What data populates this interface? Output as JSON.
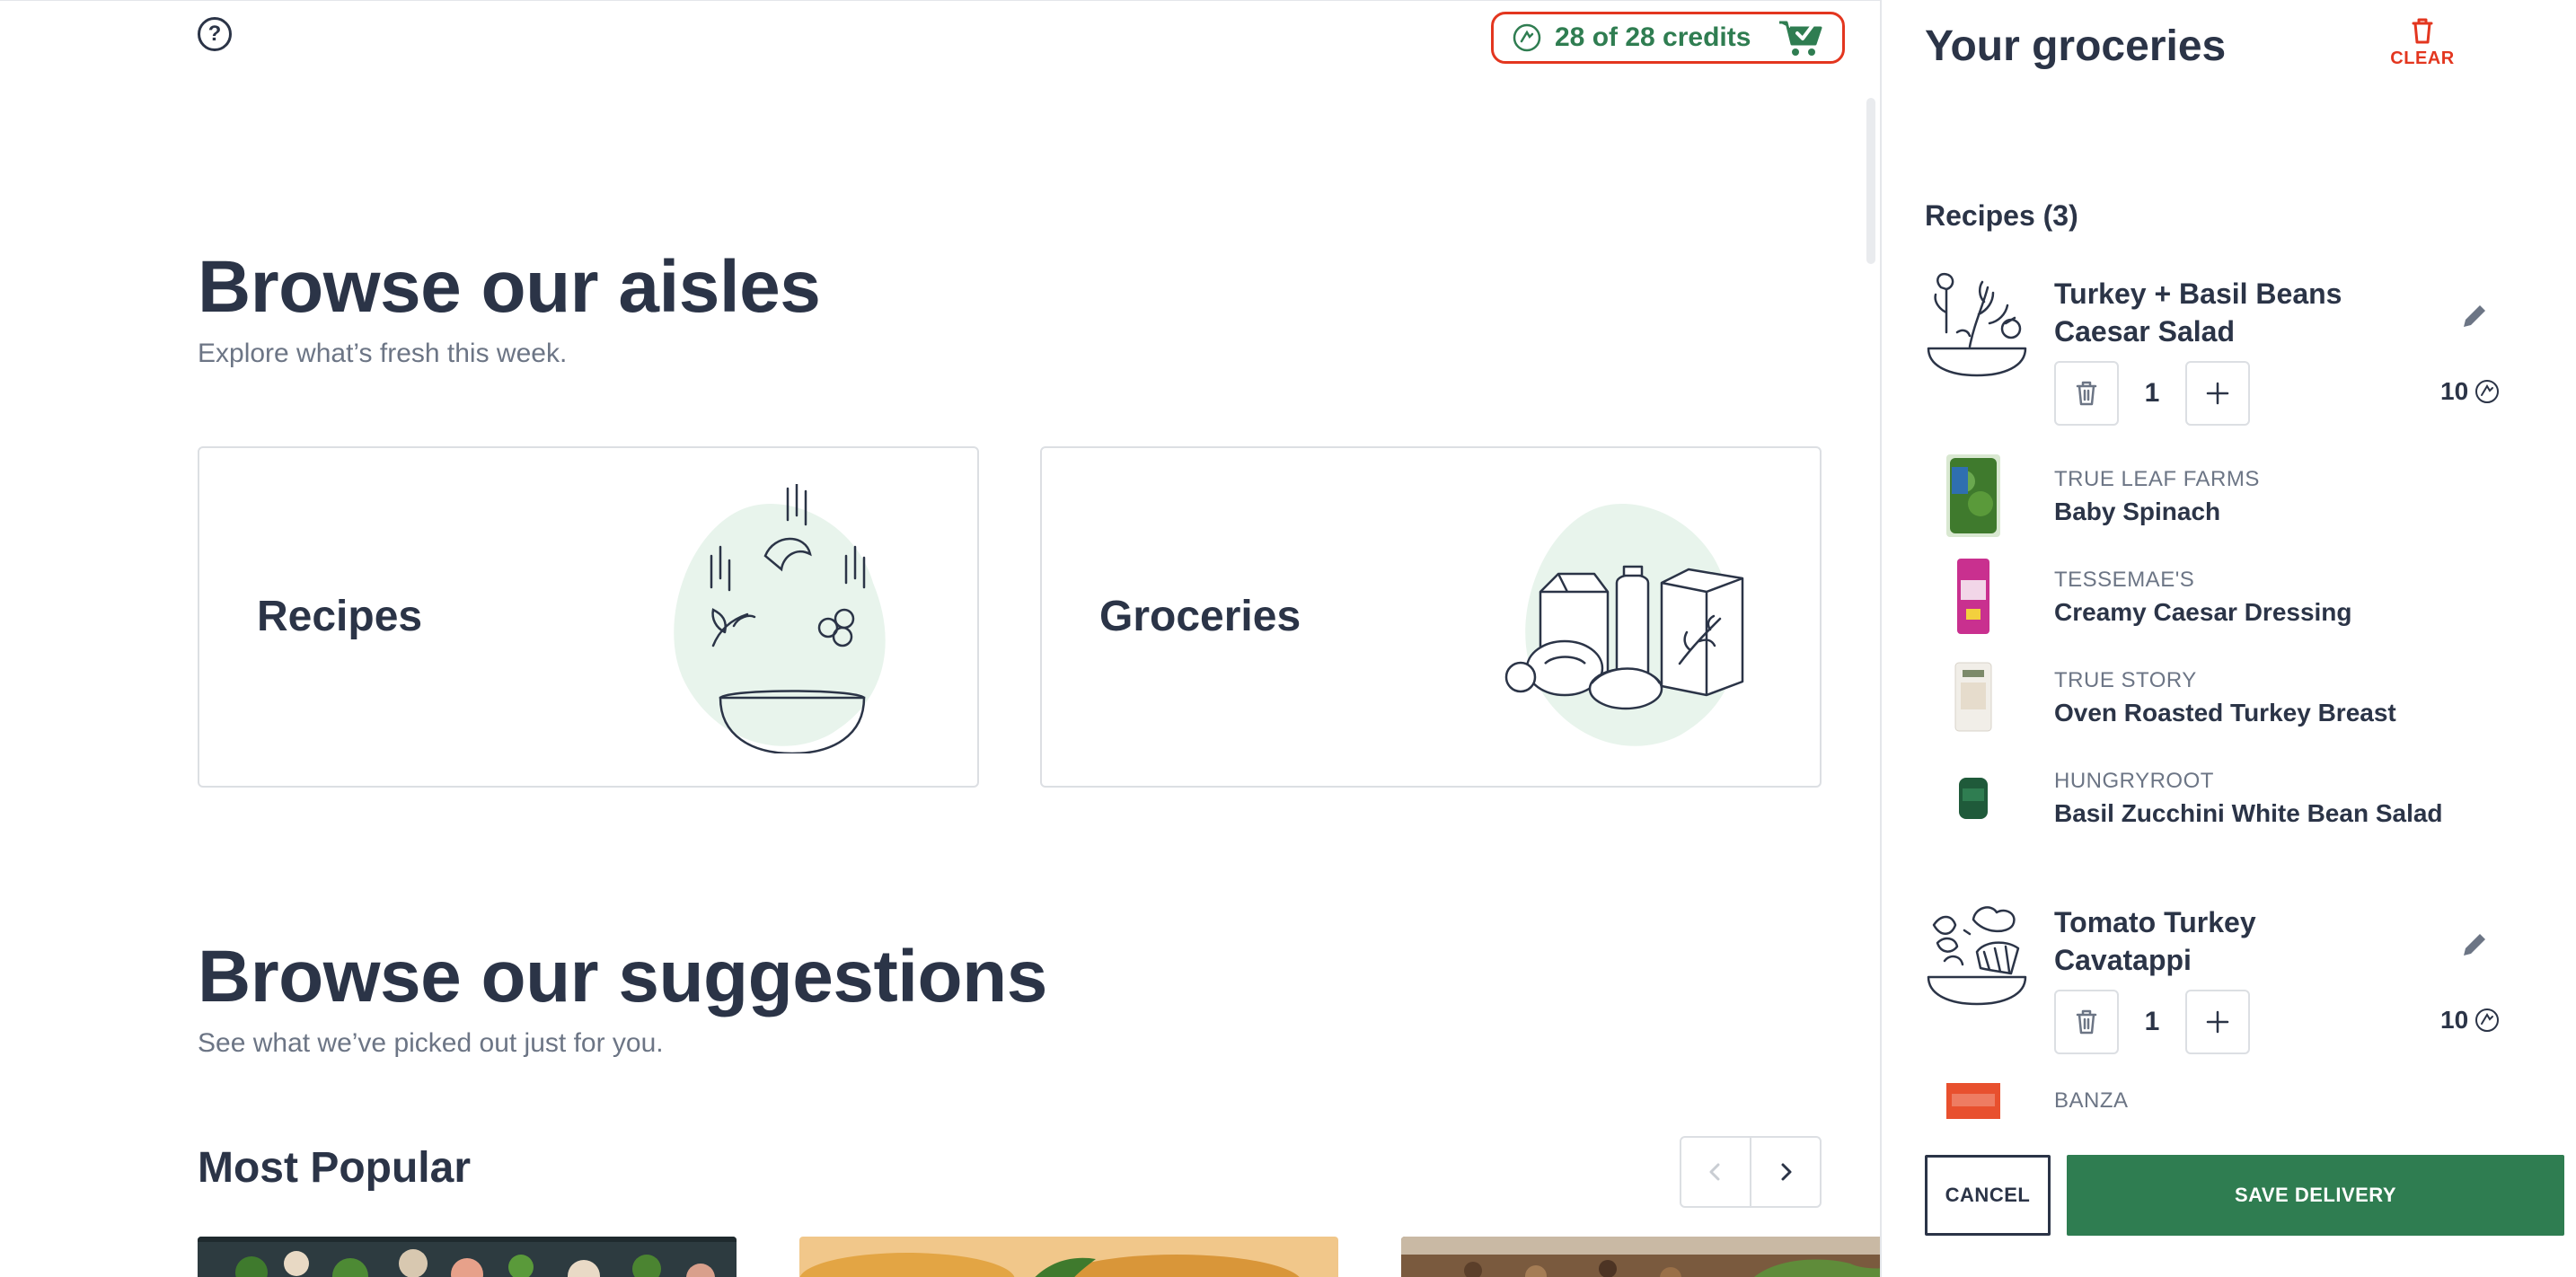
{
  "header": {
    "help_icon": "question-circle-icon",
    "credits_text": "28 of 28 credits",
    "credits_icon": "credit-coin-icon",
    "cart_icon": "cart-check-icon"
  },
  "aisles": {
    "title": "Browse our aisles",
    "subtitle": "Explore what’s fresh this week.",
    "cards": [
      {
        "label": "Recipes",
        "icon": "salad-bowl-illustration"
      },
      {
        "label": "Groceries",
        "icon": "grocery-items-illustration"
      }
    ]
  },
  "suggestions": {
    "title": "Browse our suggestions",
    "subtitle": "See what we’ve picked out just for you.",
    "row_title": "Most Popular",
    "prev_icon": "chevron-left-icon",
    "next_icon": "chevron-right-icon"
  },
  "sidebar": {
    "title": "Your groceries",
    "clear_label": "CLEAR",
    "recipes_label": "Recipes (3)",
    "recipes": [
      {
        "name": "Turkey + Basil Beans Caesar Salad",
        "quantity": "1",
        "credits": "10",
        "ingredients": [
          {
            "brand": "TRUE LEAF FARMS",
            "name": "Baby Spinach"
          },
          {
            "brand": "TESSEMAE'S",
            "name": "Creamy Caesar Dressing"
          },
          {
            "brand": "TRUE STORY",
            "name": "Oven Roasted Turkey Breast"
          },
          {
            "brand": "HUNGRYROOT",
            "name": "Basil Zucchini White Bean Salad"
          }
        ]
      },
      {
        "name": "Tomato Turkey Cavatappi",
        "quantity": "1",
        "credits": "10",
        "ingredients": [
          {
            "brand": "BANZA",
            "name": ""
          }
        ]
      }
    ],
    "cancel_label": "CANCEL",
    "save_label": "SAVE DELIVERY"
  },
  "colors": {
    "accent_green": "#2f7d51",
    "alert_red": "#e3361f",
    "text_dark": "#2b3447",
    "text_muted": "#6c7585",
    "illus_bg": "#e8f4ec"
  }
}
